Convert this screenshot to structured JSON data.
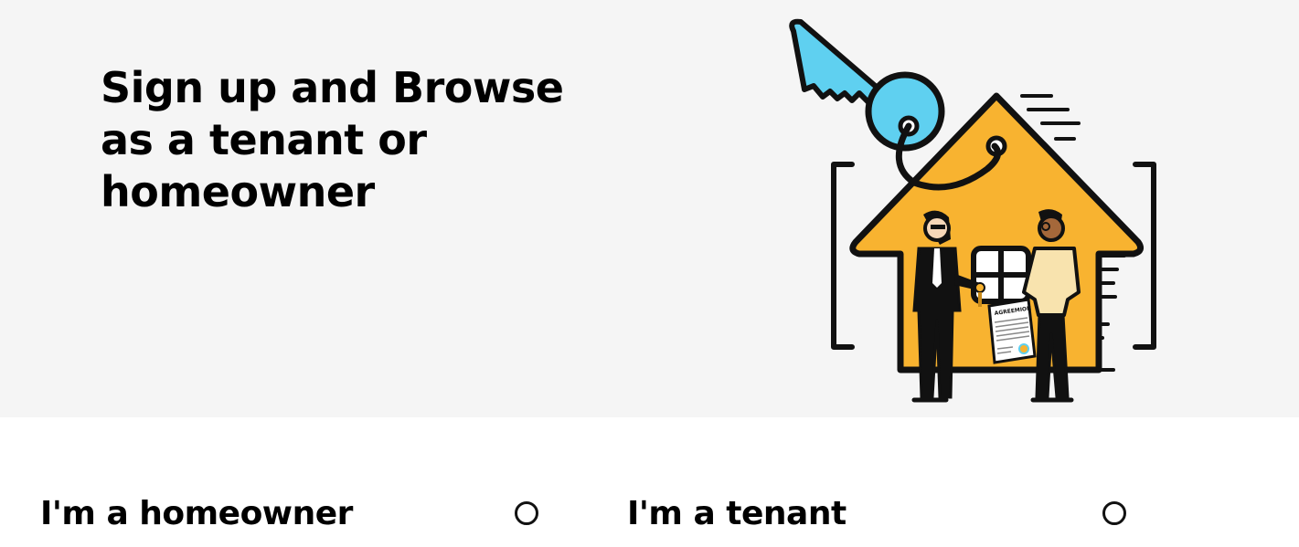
{
  "hero": {
    "title_lines": [
      "Sign up and Browse",
      "as a tenant or",
      "homeowner"
    ],
    "illustration": {
      "icon": "house-key-agreement-illustration",
      "document_label": "AGREEMION"
    }
  },
  "options": [
    {
      "label": "I'm a homeowner",
      "selected": false
    },
    {
      "label": "I'm a tenant",
      "selected": false
    }
  ],
  "colors": {
    "hero_background": "#f5f5f5",
    "house": "#f8b330",
    "key": "#5fd0f0",
    "outline": "#111111"
  }
}
